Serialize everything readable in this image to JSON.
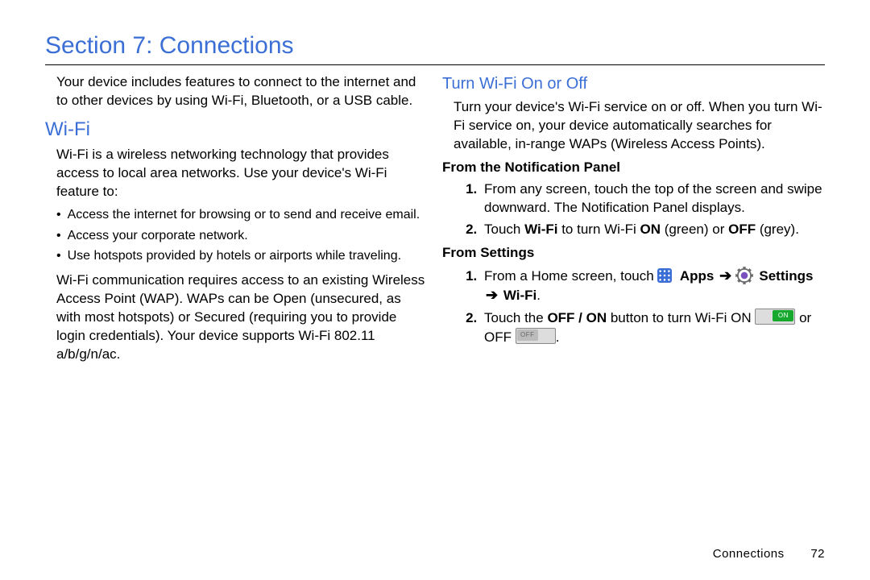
{
  "section_title": "Section 7: Connections",
  "left": {
    "intro": "Your device includes features to connect to the internet and to other devices by using Wi-Fi, Bluetooth, or a USB cable.",
    "wifi_heading": "Wi-Fi",
    "wifi_intro": "Wi-Fi is a wireless networking technology that provides access to local area networks. Use your device's Wi-Fi feature to:",
    "bullets": [
      "Access the internet for browsing or to send and receive email.",
      "Access your corporate network.",
      "Use hotspots provided by hotels or airports while traveling."
    ],
    "wifi_expl": "Wi-Fi communication requires access to an existing Wireless Access Point (WAP). WAPs can be Open (unsecured, as with most hotspots) or Secured (requiring you to provide login credentials). Your device supports Wi-Fi 802.11 a/b/g/n/ac."
  },
  "right": {
    "turn_heading": "Turn Wi-Fi On or Off",
    "turn_intro": "Turn your device's Wi-Fi service on or off. When you turn Wi-Fi service on, your device automatically searches for available, in-range WAPs (Wireless Access Points).",
    "sub1": "From the Notification Panel",
    "notif_steps": {
      "s1": "From any screen, touch the top of the screen and swipe downward. The Notification Panel displays.",
      "s2_pre": "Touch ",
      "s2_b1": "Wi-Fi",
      "s2_mid": " to turn Wi-Fi ",
      "s2_b2": "ON",
      "s2_mid2": " (green) or ",
      "s2_b3": "OFF",
      "s2_end": " (grey)."
    },
    "sub2": "From Settings",
    "settings_steps": {
      "s1_pre": "From a Home screen, touch ",
      "s1_apps": "Apps",
      "s1_settings": "Settings",
      "s1_wifi": "Wi-Fi",
      "s2_pre": "Touch the ",
      "s2_b": "OFF / ON",
      "s2_mid": " button to turn Wi-Fi ON ",
      "s2_or": " or OFF ",
      "s2_end": "."
    },
    "toggle_on_label": "ON",
    "toggle_off_label": "OFF"
  },
  "footer": {
    "chapter": "Connections",
    "page": "72"
  }
}
